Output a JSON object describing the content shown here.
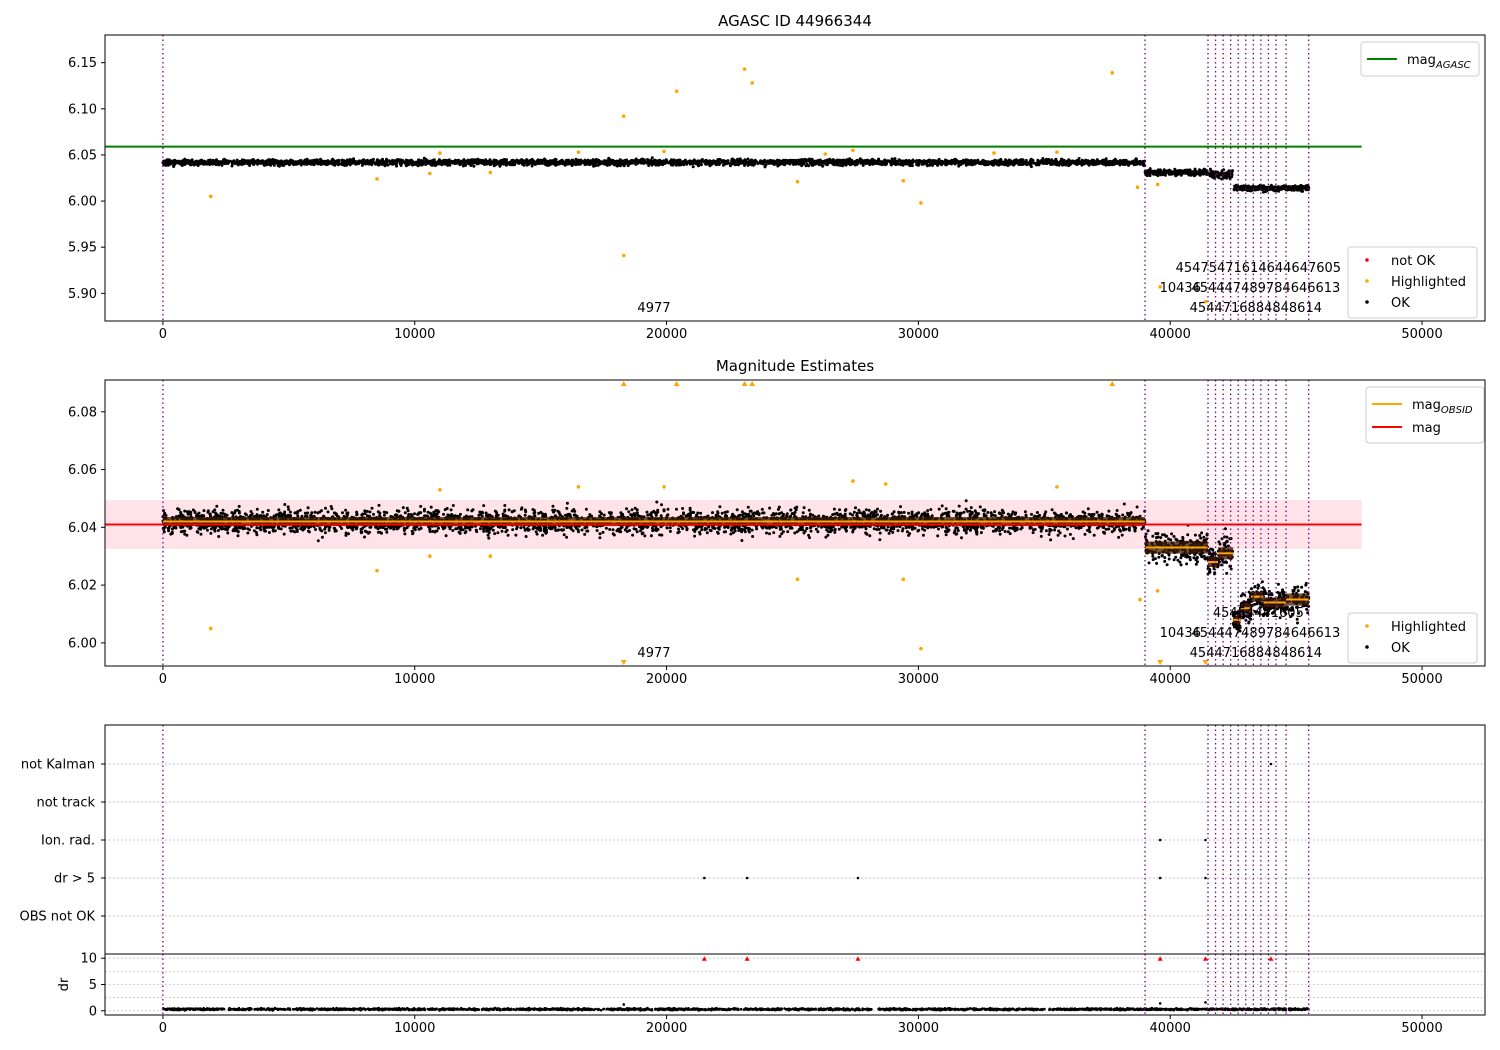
{
  "colors": {
    "ok": "#000000",
    "highlighted": "#ffa500",
    "not_ok": "#ff0000",
    "agasc_line": "#008000",
    "obsid_mag": "#ffa500",
    "mean_mag": "#ff0000",
    "band": "#ffc0cb",
    "obsid_divider": "#800080",
    "grid": "#b0b0b0"
  },
  "chart_data": [
    {
      "type": "scatter",
      "title": "AGASC ID 44966344",
      "xlim": [
        -2300,
        52500
      ],
      "ylim": [
        5.87,
        6.18
      ],
      "x_ticks": [
        0,
        10000,
        20000,
        30000,
        40000,
        50000
      ],
      "y_ticks": [
        5.9,
        5.95,
        6.0,
        6.05,
        6.1,
        6.15
      ],
      "y_tick_labels": [
        "5.90",
        "5.95",
        "6.00",
        "6.05",
        "6.10",
        "6.15"
      ],
      "legend": {
        "placement": "top-right",
        "entries": [
          {
            "label": "mag",
            "subscript": "AGASC",
            "kind": "line",
            "color": "#008000"
          }
        ]
      },
      "legend2": {
        "placement": "bottom-right",
        "entries": [
          {
            "label": "not OK",
            "kind": "marker",
            "color": "#ff0000"
          },
          {
            "label": "Highlighted",
            "kind": "marker",
            "color": "#ffa500"
          },
          {
            "label": "OK",
            "kind": "marker",
            "color": "#000000"
          }
        ]
      },
      "agasc_mag": 6.059,
      "agasc_line_x": [
        -2300,
        47600
      ],
      "obs_segments": [
        {
          "x0": 0,
          "x1": 39000,
          "mean": 6.042,
          "spread": 0.004
        },
        {
          "x0": 39000,
          "x1": 41500,
          "mean": 6.031,
          "spread": 0.004
        },
        {
          "x0": 41500,
          "x1": 42500,
          "mean": 6.029,
          "spread": 0.005
        },
        {
          "x0": 42500,
          "x1": 45500,
          "mean": 6.014,
          "spread": 0.004
        }
      ],
      "highlighted_points": [
        {
          "x": 1900,
          "y": 6.005
        },
        {
          "x": 8500,
          "y": 6.024
        },
        {
          "x": 10600,
          "y": 6.03
        },
        {
          "x": 13000,
          "y": 6.031
        },
        {
          "x": 18300,
          "y": 6.092
        },
        {
          "x": 18300,
          "y": 5.941
        },
        {
          "x": 20400,
          "y": 6.119
        },
        {
          "x": 23100,
          "y": 6.143
        },
        {
          "x": 23400,
          "y": 6.128
        },
        {
          "x": 25200,
          "y": 6.021
        },
        {
          "x": 27400,
          "y": 6.055
        },
        {
          "x": 29400,
          "y": 6.022
        },
        {
          "x": 30100,
          "y": 5.998
        },
        {
          "x": 37700,
          "y": 6.139
        },
        {
          "x": 38700,
          "y": 6.015
        },
        {
          "x": 39500,
          "y": 6.018
        },
        {
          "x": 39600,
          "y": 5.907
        },
        {
          "x": 41400,
          "y": 5.891
        },
        {
          "x": 11000,
          "y": 6.052
        },
        {
          "x": 16500,
          "y": 6.053
        },
        {
          "x": 19900,
          "y": 6.054
        },
        {
          "x": 26300,
          "y": 6.051
        },
        {
          "x": 33000,
          "y": 6.052
        },
        {
          "x": 35500,
          "y": 6.053
        }
      ],
      "obsid_dividers": [
        0,
        39000,
        41500,
        41800,
        42100,
        42400,
        42700,
        43000,
        43300,
        43600,
        43900,
        44200,
        44600,
        45500
      ],
      "obsid_labels": [
        {
          "text": "4977",
          "x": 19500,
          "row": 0
        },
        {
          "text": "10436",
          "x": 40400,
          "row": 1
        },
        {
          "text": "45475471614644647605",
          "x": 43500,
          "row": 2
        },
        {
          "text": "454447489784646613",
          "x": 43800,
          "row": 1
        },
        {
          "text": "4544716884848614",
          "x": 43400,
          "row": 0
        }
      ]
    },
    {
      "type": "scatter",
      "title": "Magnitude Estimates",
      "xlim": [
        -2300,
        52500
      ],
      "ylim": [
        5.992,
        6.091
      ],
      "x_ticks": [
        0,
        10000,
        20000,
        30000,
        40000,
        50000
      ],
      "y_ticks": [
        6.0,
        6.02,
        6.04,
        6.06,
        6.08
      ],
      "y_tick_labels": [
        "6.00",
        "6.02",
        "6.04",
        "6.06",
        "6.08"
      ],
      "legend": {
        "placement": "top-right",
        "entries": [
          {
            "label": "mag",
            "subscript": "OBSID",
            "kind": "line",
            "color": "#ffa500"
          },
          {
            "label": "mag",
            "kind": "line",
            "color": "#ff0000"
          }
        ]
      },
      "legend2": {
        "placement": "bottom-right",
        "entries": [
          {
            "label": "Highlighted",
            "kind": "marker",
            "color": "#ffa500"
          },
          {
            "label": "OK",
            "kind": "marker",
            "color": "#000000"
          }
        ]
      },
      "mean_mag": 6.041,
      "band": [
        6.0325,
        6.0495
      ],
      "band_x": [
        -2300,
        47600
      ],
      "obs_segments": [
        {
          "x0": 0,
          "x1": 39000,
          "mean": 6.042,
          "spread": 0.0045
        },
        {
          "x0": 39000,
          "x1": 41500,
          "mean": 6.033,
          "spread": 0.006
        },
        {
          "x0": 41500,
          "x1": 41900,
          "mean": 6.028,
          "spread": 0.005
        },
        {
          "x0": 41900,
          "x1": 42500,
          "mean": 6.031,
          "spread": 0.006
        },
        {
          "x0": 42500,
          "x1": 42800,
          "mean": 6.008,
          "spread": 0.004
        },
        {
          "x0": 42800,
          "x1": 43200,
          "mean": 6.012,
          "spread": 0.005
        },
        {
          "x0": 43200,
          "x1": 43700,
          "mean": 6.016,
          "spread": 0.005
        },
        {
          "x0": 43700,
          "x1": 44100,
          "mean": 6.014,
          "spread": 0.005
        },
        {
          "x0": 44100,
          "x1": 44600,
          "mean": 6.014,
          "spread": 0.005
        },
        {
          "x0": 44600,
          "x1": 45500,
          "mean": 6.015,
          "spread": 0.006
        }
      ],
      "highlighted_points": [
        {
          "x": 1900,
          "y": 6.005
        },
        {
          "x": 8500,
          "y": 6.025
        },
        {
          "x": 10600,
          "y": 6.03
        },
        {
          "x": 13000,
          "y": 6.03
        },
        {
          "x": 25200,
          "y": 6.022
        },
        {
          "x": 29400,
          "y": 6.022
        },
        {
          "x": 30100,
          "y": 5.998
        },
        {
          "x": 38800,
          "y": 6.015
        },
        {
          "x": 39500,
          "y": 6.018
        },
        {
          "x": 11000,
          "y": 6.053
        },
        {
          "x": 16500,
          "y": 6.054
        },
        {
          "x": 19900,
          "y": 6.054
        },
        {
          "x": 27400,
          "y": 6.056
        },
        {
          "x": 28700,
          "y": 6.055
        },
        {
          "x": 35500,
          "y": 6.054
        }
      ],
      "out_of_range_up": [
        18300,
        20400,
        23100,
        23400,
        37700
      ],
      "out_of_range_down": [
        18300,
        39600,
        41400
      ],
      "obsid_dividers": [
        0,
        39000,
        41500,
        41800,
        42100,
        42400,
        42700,
        43000,
        43300,
        43600,
        43900,
        44200,
        44600,
        45500
      ],
      "obsid_labels": [
        {
          "text": "4977",
          "x": 19500,
          "row": 0
        },
        {
          "text": "10436",
          "x": 40400,
          "row": 1
        },
        {
          "text": "45454441605",
          "x": 43500,
          "row": 2
        },
        {
          "text": "454447489784646613",
          "x": 43800,
          "row": 1
        },
        {
          "text": "4544716884848614",
          "x": 43400,
          "row": 0
        }
      ]
    },
    {
      "type": "scatter",
      "title": "",
      "xlim": [
        -2300,
        52500
      ],
      "flag_rows": [
        "not Kalman",
        "not track",
        "Ion. rad.",
        "dr > 5",
        "OBS not OK"
      ],
      "flag_points": [
        {
          "row": "dr > 5",
          "x": 21500
        },
        {
          "row": "dr > 5",
          "x": 23200
        },
        {
          "row": "dr > 5",
          "x": 27600
        },
        {
          "row": "dr > 5",
          "x": 39600
        },
        {
          "row": "dr > 5",
          "x": 41400
        },
        {
          "row": "Ion. rad.",
          "x": 39600
        },
        {
          "row": "Ion. rad.",
          "x": 41400
        },
        {
          "row": "not Kalman",
          "x": 44000
        }
      ],
      "obsid_dividers": [
        0,
        39000,
        41500,
        41800,
        42100,
        42400,
        42700,
        43000,
        43300,
        43600,
        43900,
        44200,
        44600,
        45500
      ]
    },
    {
      "type": "scatter",
      "title": "",
      "ylabel": "dr",
      "xlim": [
        -2300,
        52500
      ],
      "ylim": [
        -0.8,
        10.8
      ],
      "x_ticks": [
        0,
        10000,
        20000,
        30000,
        40000,
        50000
      ],
      "y_ticks": [
        0,
        5,
        10
      ],
      "y_tick_labels": [
        "0",
        "5",
        "10"
      ],
      "dr_mean": 0.3,
      "dr_points_range": [
        0,
        45500
      ],
      "clipped_points": [
        21500,
        23200,
        27600,
        39600,
        41400,
        44000
      ],
      "dr_outliers": [
        {
          "x": 18300,
          "y": 1.2
        },
        {
          "x": 39600,
          "y": 1.4
        },
        {
          "x": 41400,
          "y": 1.6
        }
      ],
      "obsid_dividers": [
        0,
        39000,
        41500,
        41800,
        42100,
        42400,
        42700,
        43000,
        43300,
        43600,
        43900,
        44200,
        44600,
        45500
      ]
    }
  ]
}
